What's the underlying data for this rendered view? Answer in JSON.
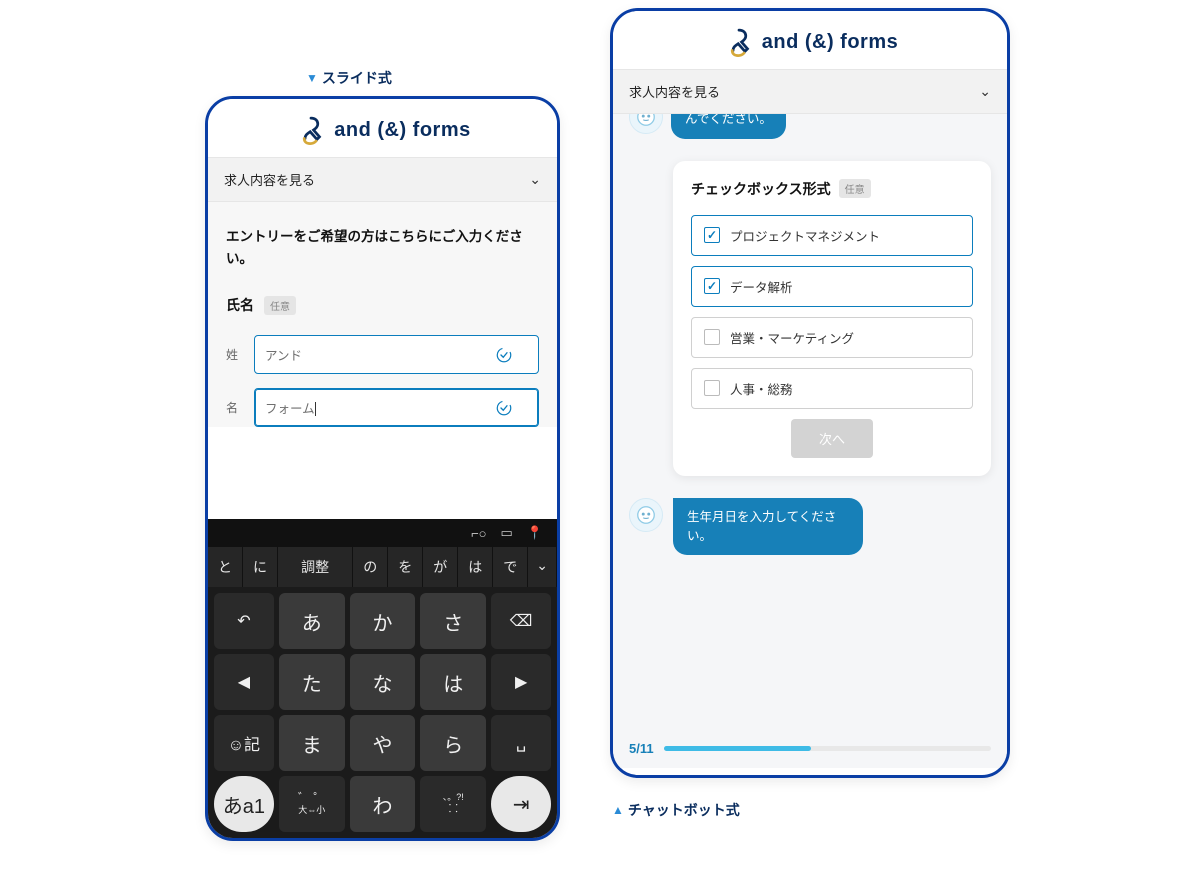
{
  "captions": {
    "left": "スライド式",
    "right": "チャットボット式"
  },
  "logo_text": "and (&) forms",
  "accordion_label": "求人内容を見る",
  "left": {
    "intro": "エントリーをご希望の方はこちらにご入力ください。",
    "name_label": "氏名",
    "optional_badge": "任意",
    "last_label": "姓",
    "first_label": "名",
    "last_value": "アンド",
    "first_value": "フォーム",
    "keyboard": {
      "suggestions": [
        "と",
        "に",
        "調整",
        "の",
        "を",
        "が",
        "は",
        "で"
      ],
      "rows": [
        [
          "↶",
          "あ",
          "か",
          "さ",
          "⌫"
        ],
        [
          "◀",
          "た",
          "な",
          "は",
          "▶"
        ],
        [
          "☺記",
          "ま",
          "や",
          "ら",
          "␣"
        ],
        [
          "あa1",
          "゛゜\n大⇔小",
          "わ",
          "、。?!\n⸬",
          "⇥"
        ]
      ]
    }
  },
  "right": {
    "bubble_top": "んでください。",
    "card_title": "チェックボックス形式",
    "optional_badge": "任意",
    "options": [
      {
        "label": "プロジェクトマネジメント",
        "checked": true
      },
      {
        "label": "データ解析",
        "checked": true
      },
      {
        "label": "営業・マーケティング",
        "checked": false
      },
      {
        "label": "人事・総務",
        "checked": false
      }
    ],
    "next_label": "次へ",
    "bubble_bottom": "生年月日を入力してください。",
    "progress": {
      "current": 5,
      "total": 11,
      "label": "5/11",
      "percent": 45
    }
  }
}
